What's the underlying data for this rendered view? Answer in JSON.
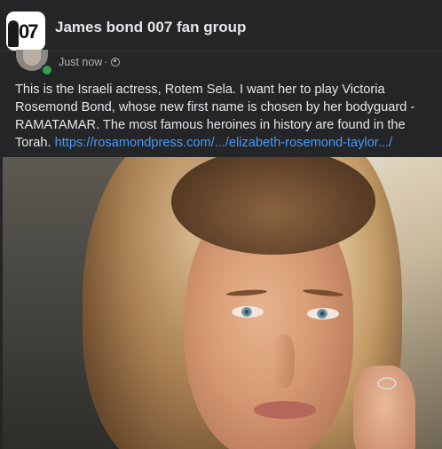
{
  "header": {
    "group_name": "James bond 007 fan group",
    "group_avatar_icon": "group-logo-icon",
    "group_avatar_text": "07"
  },
  "post": {
    "author_avatar_icon": "author-avatar",
    "author_online": true,
    "timestamp": "Just now",
    "separator": "·",
    "privacy_icon": "globe-icon",
    "text": "This is the Israeli actress, Rotem Sela. I want her to play Victoria Rosemond Bond, whose new first name is chosen by her bodyguard - RAMATAMAR. The most famous heroines in history are found in the Torah.",
    "link_text": "https://rosamondpress.com/.../elizabeth-rosemond-taylor.../",
    "photo_icon": "post-photo"
  },
  "colors": {
    "background": "#242526",
    "primary_text": "#e4e6eb",
    "secondary_text": "#b0b3b8",
    "link": "#4599ff",
    "online": "#31a24c"
  }
}
